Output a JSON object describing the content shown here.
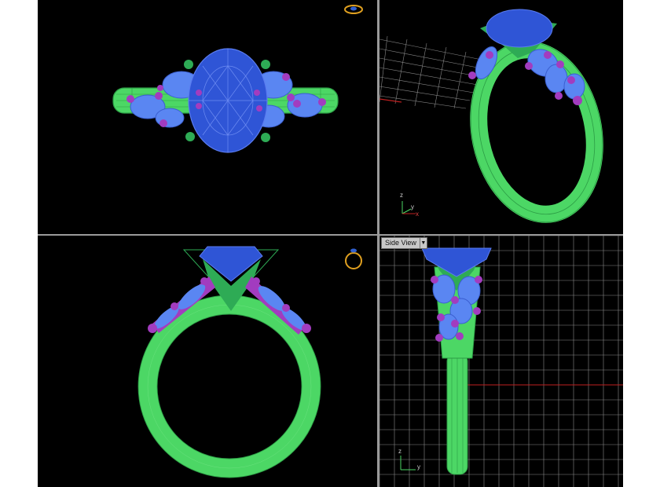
{
  "viewports": {
    "side": {
      "label": "Side View"
    }
  },
  "axes": {
    "z": "z",
    "y": "y",
    "x": "x"
  },
  "colors": {
    "background": "#000000",
    "band": "#4cd765",
    "center_stone": "#2f55d6",
    "side_stones": "#5a86f2",
    "prongs": "#a23cbf",
    "head_prongs": "#2eab55",
    "grid": "#8a8a8a",
    "x_axis": "#c02020",
    "separator": "#9a9a9a"
  },
  "icons": [
    "ring-icon-gold-top",
    "ring-icon-gold-front"
  ]
}
